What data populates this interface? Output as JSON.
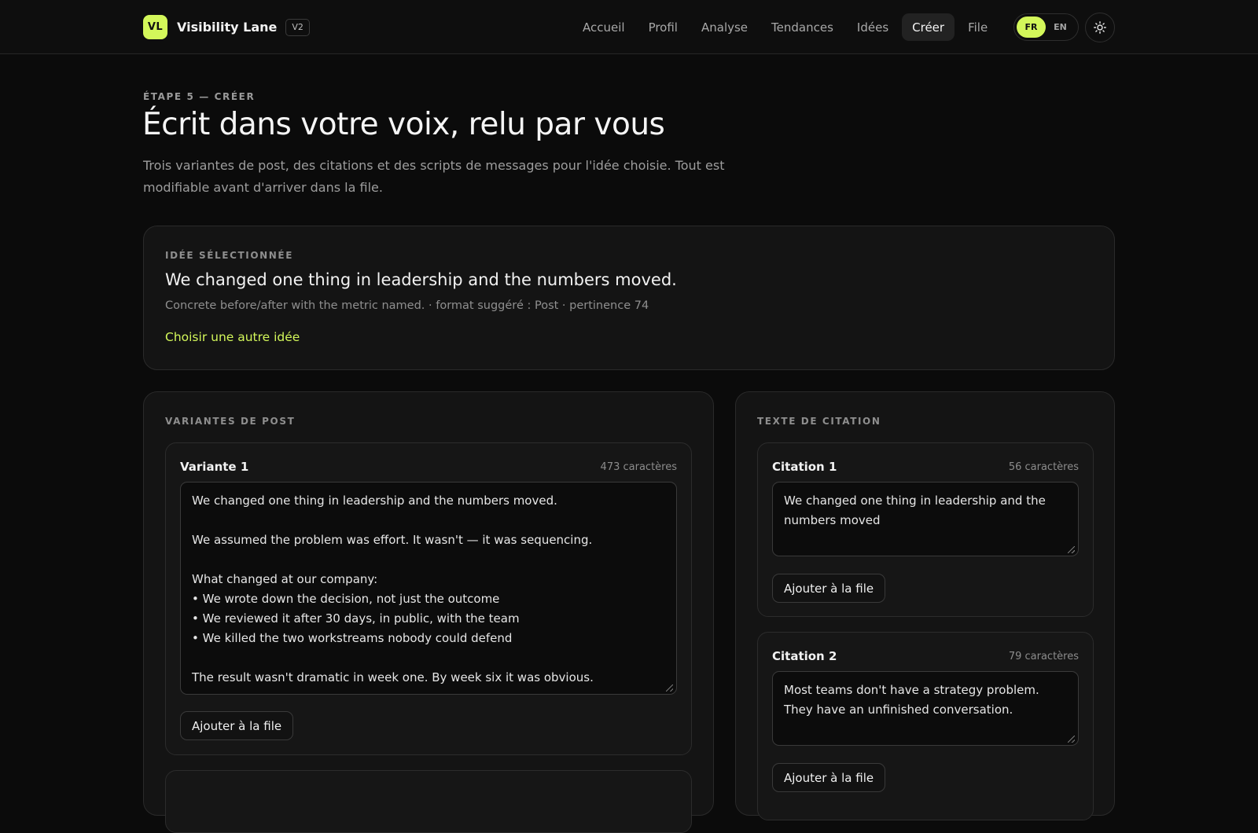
{
  "brand": {
    "logo": "VL",
    "name": "Visibility Lane",
    "version": "V2"
  },
  "nav": {
    "items": [
      {
        "label": "Accueil",
        "active": false
      },
      {
        "label": "Profil",
        "active": false
      },
      {
        "label": "Analyse",
        "active": false
      },
      {
        "label": "Tendances",
        "active": false
      },
      {
        "label": "Idées",
        "active": false
      },
      {
        "label": "Créer",
        "active": true
      },
      {
        "label": "File",
        "active": false
      }
    ]
  },
  "language": {
    "options": [
      "FR",
      "EN"
    ],
    "selected": "FR"
  },
  "theme_toggle_icon": "sun-icon",
  "hero": {
    "eyebrow": "ÉTAPE 5 — CRÉER",
    "title": "Écrit dans votre voix, relu par vous",
    "subtitle": "Trois variantes de post, des citations et des scripts de messages pour l'idée choisie. Tout est modifiable avant d'arriver dans la file."
  },
  "selected_idea": {
    "label": "IDÉE SÉLECTIONNÉE",
    "title": "We changed one thing in leadership and the numbers moved.",
    "meta": "Concrete before/after with the metric named. · format suggéré : Post · pertinence 74",
    "change_link": "Choisir une autre idée"
  },
  "variants": {
    "label": "VARIANTES DE POST",
    "items": [
      {
        "title": "Variante 1",
        "count": "473 caractères",
        "text": "We changed one thing in leadership and the numbers moved.\n\nWe assumed the problem was effort. It wasn't — it was sequencing.\n\nWhat changed at our company:\n• We wrote down the decision, not just the outcome\n• We reviewed it after 30 days, in public, with the team\n• We killed the two workstreams nobody could defend\n\nThe result wasn't dramatic in week one. By week six it was obvious.",
        "button": "Ajouter à la file"
      }
    ]
  },
  "quotes": {
    "label": "TEXTE DE CITATION",
    "items": [
      {
        "title": "Citation 1",
        "count": "56 caractères",
        "text": "We changed one thing in leadership and the numbers moved",
        "button": "Ajouter à la file"
      },
      {
        "title": "Citation 2",
        "count": "79 caractères",
        "text": "Most teams don't have a strategy problem. They have an unfinished conversation.",
        "button": "Ajouter à la file"
      }
    ]
  },
  "colors": {
    "accent": "#d3f75a",
    "background": "#0b0b0b",
    "card": "#141414"
  }
}
